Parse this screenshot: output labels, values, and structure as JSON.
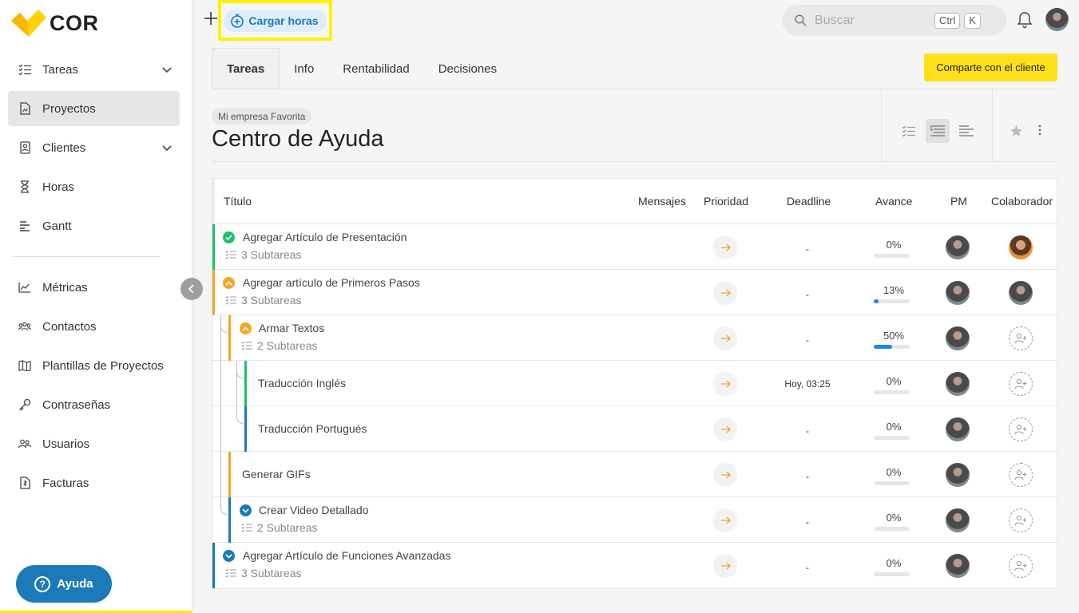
{
  "brand": {
    "name": "COR",
    "accent": "#ffe01b",
    "primary": "#1c7ab8"
  },
  "sidebar": {
    "items": [
      {
        "label": "Tareas",
        "icon": "checklist-icon",
        "has_chevron": true
      },
      {
        "label": "Proyectos",
        "icon": "document-icon",
        "active": true
      },
      {
        "label": "Clientes",
        "icon": "contact-card-icon",
        "has_chevron": true
      },
      {
        "label": "Horas",
        "icon": "hourglass-icon"
      },
      {
        "label": "Gantt",
        "icon": "gantt-icon"
      },
      {
        "label": "Métricas",
        "icon": "chart-icon"
      },
      {
        "label": "Contactos",
        "icon": "people-icon"
      },
      {
        "label": "Plantillas de Proyectos",
        "icon": "map-icon"
      },
      {
        "label": "Contraseñas",
        "icon": "key-icon"
      },
      {
        "label": "Usuarios",
        "icon": "users-icon"
      },
      {
        "label": "Facturas",
        "icon": "invoice-icon"
      }
    ],
    "help_label": "Ayuda"
  },
  "topbar": {
    "cargar_horas_label": "Cargar horas",
    "search_placeholder": "Buscar",
    "shortcut_keys": [
      "Ctrl",
      "K"
    ]
  },
  "tabs": [
    {
      "label": "Tareas",
      "active": true
    },
    {
      "label": "Info"
    },
    {
      "label": "Rentabilidad"
    },
    {
      "label": "Decisiones"
    }
  ],
  "share_button_label": "Comparte con el cliente",
  "project": {
    "company": "Mi empresa Favorita",
    "title": "Centro de Ayuda"
  },
  "table": {
    "columns": {
      "title": "Título",
      "messages": "Mensajes",
      "priority": "Prioridad",
      "deadline": "Deadline",
      "progress": "Avance",
      "pm": "PM",
      "collaborator": "Colaborador"
    },
    "rows": [
      {
        "name": "Agregar Artículo de Presentación",
        "subtasks": "3 Subtareas",
        "status": "done",
        "bar_color": "#1fbf6b",
        "deadline": "-",
        "progress_label": "0%",
        "progress": 0,
        "collaborator": "avatar-orange"
      },
      {
        "name": "Agregar artículo de Primeros Pasos",
        "subtasks": "3 Subtareas",
        "status": "up",
        "bar_color": "#f5a623",
        "deadline": "-",
        "progress_label": "13%",
        "progress": 13,
        "collaborator": "avatar"
      },
      {
        "name": "Armar Textos",
        "subtasks": "2 Subtareas",
        "status": "up",
        "bar_color": "#f5a623",
        "deadline": "-",
        "progress_label": "50%",
        "progress": 50,
        "collaborator": "add"
      },
      {
        "name": "Traducción Inglés",
        "subtasks": "",
        "status": "none",
        "bar_color": "#1fbf6b",
        "deadline": "Hoy, 03:25",
        "progress_label": "0%",
        "progress": 0,
        "collaborator": "add"
      },
      {
        "name": "Traducción Portugués",
        "subtasks": "",
        "status": "none",
        "bar_color": "#1c7ab8",
        "deadline": "-",
        "progress_label": "0%",
        "progress": 0,
        "collaborator": "add"
      },
      {
        "name": "Generar GIFs",
        "subtasks": "",
        "status": "none",
        "bar_color": "#f5a623",
        "deadline": "-",
        "progress_label": "0%",
        "progress": 0,
        "collaborator": "add"
      },
      {
        "name": "Crear Video Detallado",
        "subtasks": "2 Subtareas",
        "status": "down",
        "bar_color": "#1c7ab8",
        "deadline": "-",
        "progress_label": "0%",
        "progress": 0,
        "collaborator": "add"
      },
      {
        "name": "Agregar Artículo de Funciones Avanzadas",
        "subtasks": "3 Subtareas",
        "status": "down",
        "bar_color": "#1c7ab8",
        "deadline": "-",
        "progress_label": "0%",
        "progress": 0,
        "collaborator": "add"
      }
    ]
  }
}
